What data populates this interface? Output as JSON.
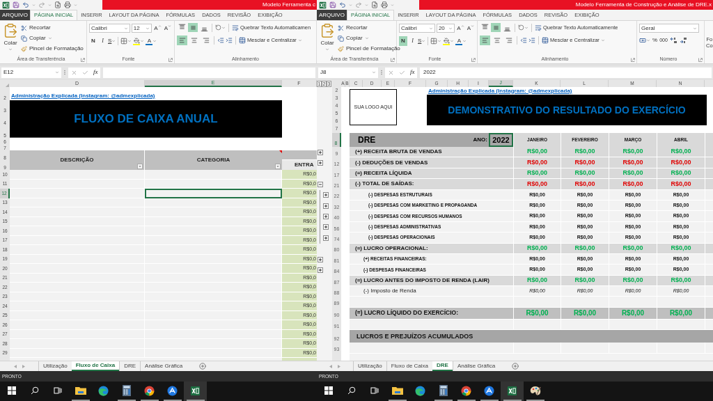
{
  "windows": [
    {
      "title": "Modelo Ferramenta c",
      "menu_tabs": [
        {
          "label": "ARQUIVO",
          "kind": "file",
          "selected": false
        },
        {
          "label": "PÁGINA INICIAL",
          "kind": "tab",
          "selected": true
        },
        {
          "label": "INSERIR",
          "kind": "tab",
          "selected": false
        },
        {
          "label": "LAYOUT DA PÁGINA",
          "kind": "tab",
          "selected": false
        },
        {
          "label": "FÓRMULAS",
          "kind": "tab",
          "selected": false
        },
        {
          "label": "DADOS",
          "kind": "tab",
          "selected": false
        },
        {
          "label": "REVISÃO",
          "kind": "tab",
          "selected": false
        },
        {
          "label": "EXIBIÇÃO",
          "kind": "tab",
          "selected": false
        }
      ],
      "ribbon": {
        "clipboard": {
          "paste": "Colar",
          "cut": "Recortar",
          "copy": "Copiar",
          "format_painter": "Pincel de Formatação",
          "label": "Área de Transferência"
        },
        "font": {
          "name": "Calibri",
          "size": "12",
          "grow": "A",
          "shrink": "A",
          "bold": "N",
          "italic": "I",
          "underline": "S",
          "font_color": "A",
          "bold_on": false,
          "label": "Fonte"
        },
        "alignment": {
          "vertical": [
            {
              "selected": false
            },
            {
              "selected": true
            },
            {
              "selected": false
            }
          ],
          "horizontal": [
            {
              "selected": true
            },
            {
              "selected": false
            },
            {
              "selected": false
            }
          ],
          "wrap": "Quebrar Texto Automaticamen",
          "merge": "Mesclar e Centralizar",
          "label": "Alinhamento"
        }
      },
      "formula_bar": {
        "name_box": "E12",
        "function_label": "fx"
      },
      "sheet": {
        "kind": "cashflow",
        "columns": [
          {
            "label": "D",
            "selected": false
          },
          {
            "label": "E",
            "selected": true
          },
          {
            "label": "F",
            "selected": false
          }
        ],
        "top_row_numbers": [
          "2",
          "3",
          "4",
          "5",
          "6",
          "7",
          "8",
          "9"
        ],
        "link": "Administração Explicada (Instagram: @admexplicada)",
        "title": "FLUXO DE CAIXA ANUAL",
        "headers": [
          "DESCRIÇÃO",
          "CATEGORIA",
          "ENTRA"
        ],
        "rows": [
          {
            "number": "10",
            "value": "R$0,0",
            "selected": false
          },
          {
            "number": "11",
            "value": "R$0,0",
            "selected": false
          },
          {
            "number": "12",
            "value": "R$0,0",
            "selected": true
          },
          {
            "number": "13",
            "value": "R$0,0",
            "selected": false
          },
          {
            "number": "14",
            "value": "R$0,0",
            "selected": false
          },
          {
            "number": "15",
            "value": "R$0,0",
            "selected": false
          },
          {
            "number": "16",
            "value": "R$0,0",
            "selected": false
          },
          {
            "number": "17",
            "value": "R$0,0",
            "selected": false
          },
          {
            "number": "18",
            "value": "R$0,0",
            "selected": false
          },
          {
            "number": "19",
            "value": "R$0,0",
            "selected": false
          },
          {
            "number": "20",
            "value": "R$0,0",
            "selected": false
          },
          {
            "number": "21",
            "value": "R$0,0",
            "selected": false
          },
          {
            "number": "22",
            "value": "R$0,0",
            "selected": false
          },
          {
            "number": "23",
            "value": "R$0,0",
            "selected": false
          },
          {
            "number": "24",
            "value": "R$0,0",
            "selected": false
          },
          {
            "number": "25",
            "value": "R$0,0",
            "selected": false
          },
          {
            "number": "26",
            "value": "R$0,0",
            "selected": false
          },
          {
            "number": "27",
            "value": "R$0,0",
            "selected": false
          },
          {
            "number": "28",
            "value": "R$0,0",
            "selected": false
          },
          {
            "number": "29",
            "value": "R$0,0",
            "selected": false
          }
        ]
      },
      "sheet_tabs": [
        {
          "label": "Utilização",
          "selected": false
        },
        {
          "label": "Fluxo de Caixa",
          "selected": true
        },
        {
          "label": "DRE",
          "selected": false
        },
        {
          "label": "Análise Gráfica",
          "selected": false
        }
      ],
      "status": "PRONTO",
      "taskbar": [
        {
          "kind": "start",
          "running": false,
          "selected": false
        },
        {
          "kind": "search",
          "running": false,
          "selected": false
        },
        {
          "kind": "task_view",
          "running": false,
          "selected": false
        },
        {
          "kind": "file_explorer",
          "running": true,
          "selected": false
        },
        {
          "kind": "edge",
          "running": false,
          "selected": false
        },
        {
          "kind": "calculator",
          "running": true,
          "selected": false
        },
        {
          "kind": "chrome",
          "running": true,
          "selected": false
        },
        {
          "kind": "round_app",
          "running": true,
          "selected": false
        },
        {
          "kind": "excel",
          "running": true,
          "selected": true
        }
      ]
    },
    {
      "title": "Modelo Ferramenta de Construção e Análise de DRE.x",
      "menu_tabs": [
        {
          "label": "ARQUIVO",
          "kind": "file",
          "selected": false
        },
        {
          "label": "PÁGINA INICIAL",
          "kind": "tab",
          "selected": true
        },
        {
          "label": "INSERIR",
          "kind": "tab",
          "selected": false
        },
        {
          "label": "LAYOUT DA PÁGINA",
          "kind": "tab",
          "selected": false
        },
        {
          "label": "FÓRMULAS",
          "kind": "tab",
          "selected": false
        },
        {
          "label": "DADOS",
          "kind": "tab",
          "selected": false
        },
        {
          "label": "REVISÃO",
          "kind": "tab",
          "selected": false
        },
        {
          "label": "EXIBIÇÃO",
          "kind": "tab",
          "selected": false
        }
      ],
      "ribbon": {
        "clipboard": {
          "paste": "Colar",
          "cut": "Recortar",
          "copy": "Copiar",
          "format_painter": "Pincel de Formatação",
          "label": "Área de Transferência"
        },
        "font": {
          "name": "Calibri",
          "size": "20",
          "grow": "A",
          "shrink": "A",
          "bold": "N",
          "italic": "I",
          "underline": "S",
          "font_color": "A",
          "bold_on": true,
          "label": "Fonte"
        },
        "alignment": {
          "vertical": [
            {
              "selected": false
            },
            {
              "selected": true
            },
            {
              "selected": false
            }
          ],
          "horizontal": [
            {
              "selected": true
            },
            {
              "selected": false
            },
            {
              "selected": false
            }
          ],
          "wrap": "Quebrar Texto Automaticamente",
          "merge": "Mesclar e Centralizar",
          "label": "Alinhamento"
        },
        "number": {
          "format": "Geral",
          "percent": "%",
          "thousands": "000",
          "label": "Número"
        },
        "next_group": [
          "Fo",
          "Co"
        ]
      },
      "formula_bar": {
        "name_box": "J8",
        "function_label": "fx",
        "value": "2022"
      },
      "sheet": {
        "kind": "dre",
        "outline_levels": [
          "1",
          "2",
          "3"
        ],
        "columns": [
          {
            "label": "A",
            "selected": false
          },
          {
            "label": "B",
            "selected": false
          },
          {
            "label": "C",
            "selected": false
          },
          {
            "label": "D",
            "selected": false
          },
          {
            "label": "E",
            "selected": false
          },
          {
            "label": "F",
            "selected": false
          },
          {
            "label": "G",
            "selected": false
          },
          {
            "label": "H",
            "selected": false
          },
          {
            "label": "I",
            "selected": false
          },
          {
            "label": "J",
            "selected": true
          },
          {
            "label": "K",
            "selected": false
          },
          {
            "label": "L",
            "selected": false
          },
          {
            "label": "M",
            "selected": false
          },
          {
            "label": "N",
            "selected": false
          }
        ],
        "top_row_numbers": [
          "2",
          "3",
          "4",
          "5",
          "6",
          "7"
        ],
        "logo": "SUA LOGO AQUI",
        "link": "Administração Explicada (Instagram: @admexplicada)",
        "title": "DEMONSTRATIVO DO RESULTADO DO EXERCÍCIO",
        "header_row": {
          "number": "8",
          "selected": true,
          "label": "DRE",
          "year_label": "ANO:",
          "year": "2022",
          "year_selected": true,
          "months": [
            "JANEIRO",
            "FEVEREIRO",
            "MARÇO",
            "ABRIL"
          ]
        },
        "rows": [
          {
            "number": "9",
            "kind": "section",
            "label": "(+) RECEITA BRUTA DE VENDAS",
            "color": "#00b050",
            "values": [
              "R$0,00",
              "R$0,00",
              "R$0,00",
              "R$0,00"
            ],
            "expanded": false
          },
          {
            "number": "12",
            "kind": "section",
            "label": "(-) DEDUÇÕES DE VENDAS",
            "color": "#e00000",
            "values": [
              "R$0,00",
              "R$0,00",
              "R$0,00",
              "R$0,00"
            ],
            "expanded": false
          },
          {
            "number": "17",
            "kind": "section",
            "label": "(=) RECEITA LÍQUIDA",
            "color": "#00b050",
            "values": [
              "R$0,00",
              "R$0,00",
              "R$0,00",
              "R$0,00"
            ]
          },
          {
            "number": "21",
            "kind": "section",
            "label": "(-) TOTAL DE SAÍDAS:",
            "color": "#e00000",
            "values": [
              "R$0,00",
              "R$0,00",
              "R$0,00",
              "R$0,00"
            ],
            "expanded": true,
            "children": [
              {
                "number": "22",
                "kind": "minor",
                "label": "(-) DESPESAS ESTRUTURAIS",
                "values": [
                  "R$0,00",
                  "R$0,00",
                  "R$0,00",
                  "R$0,00"
                ],
                "expanded": false
              },
              {
                "number": "32",
                "kind": "minor",
                "label": "(-) DESPESAS COM MARKETING E PROPAGANDA",
                "values": [
                  "R$0,00",
                  "R$0,00",
                  "R$0,00",
                  "R$0,00"
                ],
                "expanded": false
              },
              {
                "number": "40",
                "kind": "minor",
                "label": "(-) DESPESAS COM RECURSOS HUMANOS",
                "values": [
                  "R$0,00",
                  "R$0,00",
                  "R$0,00",
                  "R$0,00"
                ],
                "expanded": false
              },
              {
                "number": "56",
                "kind": "minor",
                "label": "(-) DESPESAS ADMINISTRATIVAS",
                "values": [
                  "R$0,00",
                  "R$0,00",
                  "R$0,00",
                  "R$0,00"
                ],
                "expanded": false
              },
              {
                "number": "74",
                "kind": "minor",
                "label": "(-) DESPESAS OPERACIONAIS",
                "values": [
                  "R$0,00",
                  "R$0,00",
                  "R$0,00",
                  "R$0,00"
                ],
                "expanded": false
              }
            ]
          },
          {
            "number": "80",
            "kind": "section",
            "label": "(=) LUCRO OPERACIONAL:",
            "color": "#00b050",
            "values": [
              "R$0,00",
              "R$0,00",
              "R$0,00",
              "R$0,00"
            ]
          },
          {
            "number": "81",
            "kind": "minor",
            "label": "(+) RECEITAS FINANCEIRAS:",
            "values": [
              "R$0,00",
              "R$0,00",
              "R$0,00",
              "R$0,00"
            ],
            "expanded": false
          },
          {
            "number": "84",
            "kind": "minor",
            "label": "(-) DESPESAS FINANCEIRAS",
            "values": [
              "R$0,00",
              "R$0,00",
              "R$0,00",
              "R$0,00"
            ],
            "expanded": false
          },
          {
            "number": "87",
            "kind": "section",
            "label": "(=) LUCRO ANTES DO IMPOSTO DE RENDA (LAIR)",
            "color": "#00b050",
            "values": [
              "R$0,00",
              "R$0,00",
              "R$0,00",
              "R$0,00"
            ]
          },
          {
            "number": "88",
            "kind": "tax",
            "label": "(-) Imposto de Renda",
            "values": [
              "R$0,00",
              "R$0,00",
              "R$0,00",
              "R$0,00"
            ]
          },
          {
            "number": "89",
            "kind": "blank"
          },
          {
            "number": "90",
            "kind": "total",
            "label": "(=) LUCRO LÍQUIDO DO EXERCÍCIO:",
            "color": "#00b050",
            "values": [
              "R$0,00",
              "R$0,00",
              "R$0,00",
              "R$0,00"
            ]
          },
          {
            "number": "91",
            "kind": "blank"
          },
          {
            "number": "92",
            "kind": "heading",
            "label": "LUCROS E PREJUÍZOS ACUMULADOS"
          },
          {
            "number": "93",
            "kind": "blank"
          }
        ]
      },
      "sheet_tabs": [
        {
          "label": "Utilização",
          "selected": false
        },
        {
          "label": "Fluxo de Caixa",
          "selected": false
        },
        {
          "label": "DRE",
          "selected": true
        },
        {
          "label": "Análise Gráfica",
          "selected": false
        }
      ],
      "status": "PRONTO",
      "taskbar": [
        {
          "kind": "start",
          "running": false,
          "selected": false
        },
        {
          "kind": "search",
          "running": false,
          "selected": false
        },
        {
          "kind": "task_view",
          "running": false,
          "selected": false
        },
        {
          "kind": "file_explorer",
          "running": true,
          "selected": false
        },
        {
          "kind": "edge",
          "running": false,
          "selected": false
        },
        {
          "kind": "calculator",
          "running": true,
          "selected": false
        },
        {
          "kind": "chrome",
          "running": true,
          "selected": false
        },
        {
          "kind": "round_app",
          "running": true,
          "selected": false
        },
        {
          "kind": "excel",
          "running": true,
          "selected": true
        },
        {
          "kind": "paint",
          "running": true,
          "selected": false
        }
      ]
    }
  ]
}
